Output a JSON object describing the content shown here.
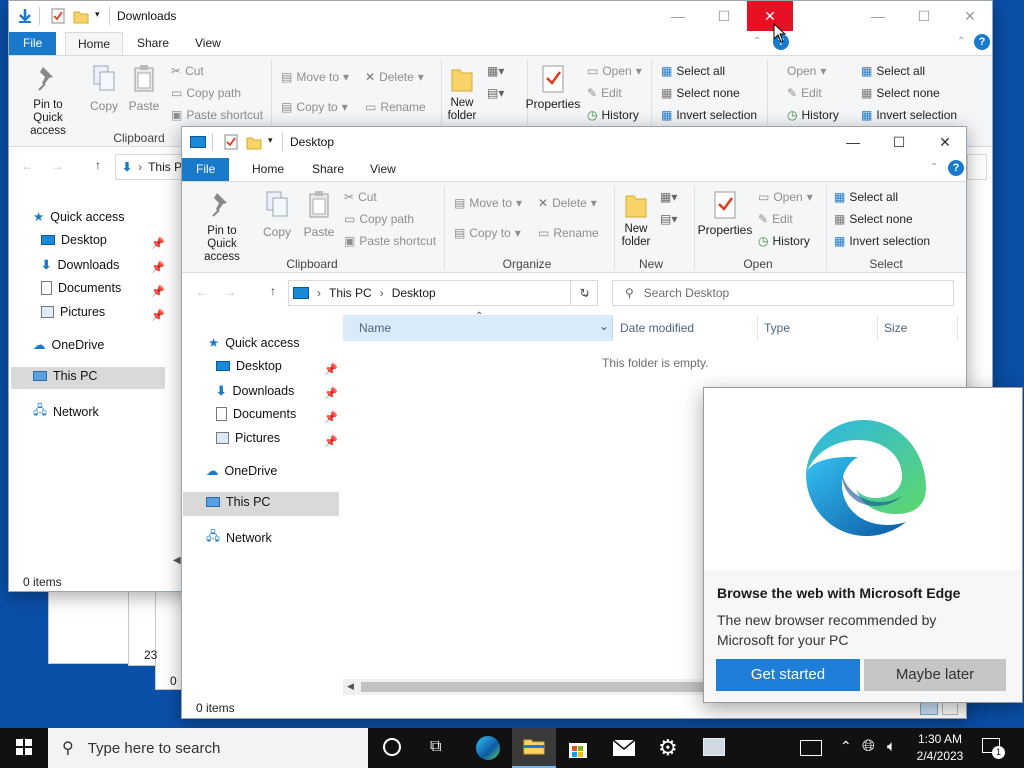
{
  "colors": {
    "accent": "#1979ca",
    "desktop": "#0a4fa8",
    "close_hover": "#e81123",
    "taskbar": "#111111",
    "edge_button": "#1f7fd8"
  },
  "back_window": {
    "title": "Downloads",
    "tabs": [
      "File",
      "Home",
      "Share",
      "View"
    ],
    "ribbon": {
      "pin_label": "Pin to Quick access",
      "copy_label": "Copy",
      "paste_label": "Paste",
      "cut_label": "Cut",
      "copy_path_label": "Copy path",
      "paste_shortcut_label": "Paste shortcut",
      "clipboard_group": "Clipboard",
      "move_to_label": "Move to",
      "copy_to_label": "Copy to",
      "delete_label": "Delete",
      "rename_label": "Rename",
      "new_folder_label": "New folder",
      "properties_label": "Properties",
      "open_label": "Open",
      "edit_label": "Edit",
      "history_label": "History",
      "select_all_label": "Select all",
      "select_none_label": "Select none",
      "invert_selection_label": "Invert selection"
    },
    "breadcrumb_partial": "This P",
    "sidebar": [
      "Quick access",
      "Desktop",
      "Downloads",
      "Documents",
      "Pictures",
      "OneDrive",
      "This PC",
      "Network"
    ],
    "status": "0 items",
    "right_ribbon": {
      "open_label": "Open",
      "edit_label": "Edit",
      "history_label": "History",
      "select_all_label": "Select all",
      "select_none_label": "Select none",
      "invert_selection_label": "Invert selection"
    }
  },
  "behind_fragments": [
    "23",
    "0"
  ],
  "front_window": {
    "title": "Desktop",
    "tabs": [
      "File",
      "Home",
      "Share",
      "View"
    ],
    "ribbon": {
      "pin_label": "Pin to Quick access",
      "copy_label": "Copy",
      "paste_label": "Paste",
      "cut_label": "Cut",
      "copy_path_label": "Copy path",
      "paste_shortcut_label": "Paste shortcut",
      "clipboard_group": "Clipboard",
      "move_to_label": "Move to",
      "copy_to_label": "Copy to",
      "delete_label": "Delete",
      "rename_label": "Rename",
      "organize_group": "Organize",
      "new_folder_label": "New folder",
      "new_group": "New",
      "properties_label": "Properties",
      "open_label": "Open",
      "edit_label": "Edit",
      "history_label": "History",
      "open_group": "Open",
      "select_all_label": "Select all",
      "select_none_label": "Select none",
      "invert_selection_label": "Invert selection",
      "select_group": "Select"
    },
    "breadcrumb": [
      "This PC",
      "Desktop"
    ],
    "search_placeholder": "Search Desktop",
    "sidebar": [
      "Quick access",
      "Desktop",
      "Downloads",
      "Documents",
      "Pictures",
      "OneDrive",
      "This PC",
      "Network"
    ],
    "columns": [
      "Name",
      "Date modified",
      "Type",
      "Size"
    ],
    "empty_message": "This folder is empty.",
    "status": "0 items"
  },
  "edge_popup": {
    "heading": "Browse the web with Microsoft Edge",
    "body": "The new browser recommended by Microsoft for your PC",
    "primary_button": "Get started",
    "secondary_button": "Maybe later"
  },
  "taskbar": {
    "search_placeholder": "Type here to search",
    "time": "1:30 AM",
    "date": "2/4/2023",
    "notification_count": "1"
  }
}
